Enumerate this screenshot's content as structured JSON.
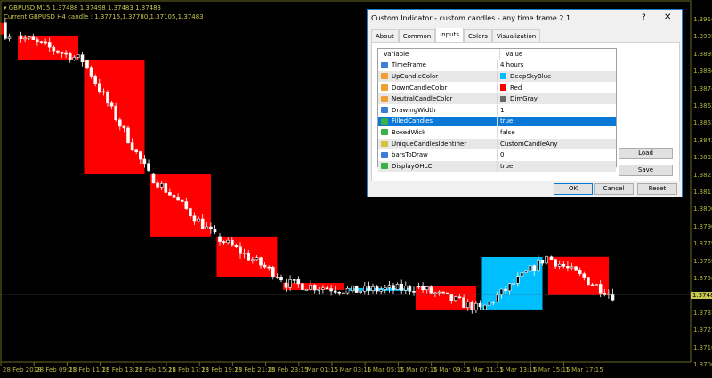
{
  "chart": {
    "symbol_line": "GBPUSD,M15  1.37488 1.37498 1.37483 1.37483",
    "h4_line": "Current GBPUSD H4 candle : 1.37716,1.37780,1.37105,1.37483",
    "up_color": "#00bfff",
    "down_color": "#ff0000",
    "price_axis": [
      "1.39160",
      "1.39055",
      "1.38950",
      "1.38845",
      "1.38740",
      "1.38635",
      "1.38530",
      "1.38425",
      "1.38320",
      "1.38215",
      "1.38110",
      "1.38005",
      "1.37900",
      "1.37795",
      "1.37690",
      "1.37585",
      "1.37483",
      "1.37375",
      "1.37270",
      "1.37165",
      "1.37060"
    ],
    "price_min": 1.3706,
    "price_max": 1.3916,
    "current_price": "1.37483",
    "time_axis": [
      "28 Feb 2018",
      "28 Feb 09:15",
      "28 Feb 11:15",
      "28 Feb 13:15",
      "28 Feb 15:15",
      "28 Feb 17:15",
      "28 Feb 19:15",
      "28 Feb 21:15",
      "28 Feb 23:15",
      "1 Mar 01:15",
      "1 Mar 03:15",
      "1 Mar 05:15",
      "1 Mar 07:15",
      "1 Mar 09:15",
      "1 Mar 11:15",
      "1 Mar 13:15",
      "1 Mar 15:15",
      "1 Mar 17:15"
    ],
    "h4_candles": [
      {
        "open": 1.3914,
        "close": 1.3907
      },
      {
        "open": 1.39063,
        "close": 1.38911
      },
      {
        "open": 1.38911,
        "close": 1.38218
      },
      {
        "open": 1.38218,
        "close": 1.3784
      },
      {
        "open": 1.3784,
        "close": 1.37591
      },
      {
        "open": 1.37558,
        "close": 1.37515
      },
      {
        "open": 1.3751,
        "close": 1.37526
      },
      {
        "open": 1.37537,
        "close": 1.37396
      },
      {
        "open": 1.37396,
        "close": 1.37715
      },
      {
        "open": 1.37716,
        "close": 1.37483
      }
    ]
  },
  "dialog": {
    "title": "Custom Indicator - custom candles - any time frame 2.1",
    "help": "?",
    "close": "✕",
    "tabs": [
      "About",
      "Common",
      "Inputs",
      "Colors",
      "Visualization"
    ],
    "columns": [
      "Variable",
      "Value"
    ],
    "rows": [
      {
        "icon": "123",
        "name": "TimeFrame",
        "value": "4 hours"
      },
      {
        "icon": "clr",
        "name": "UpCandleColor",
        "value": "DeepSkyBlue",
        "swatch": "#00bfff"
      },
      {
        "icon": "clr",
        "name": "DownCandleColor",
        "value": "Red",
        "swatch": "#ff0000"
      },
      {
        "icon": "clr",
        "name": "NeutralCandleColor",
        "value": "DimGray",
        "swatch": "#696969"
      },
      {
        "icon": "123",
        "name": "DrawingWidth",
        "value": "1"
      },
      {
        "icon": "bool",
        "name": "FilledCandles",
        "value": "true"
      },
      {
        "icon": "bool",
        "name": "BoxedWick",
        "value": "false"
      },
      {
        "icon": "ab",
        "name": "UniqueCandlesIdentifier",
        "value": "CustomCandleAny"
      },
      {
        "icon": "123",
        "name": "barsToDraw",
        "value": "0"
      },
      {
        "icon": "bool",
        "name": "DisplayOHLC",
        "value": "true"
      }
    ],
    "load": "Load",
    "save": "Save",
    "ok": "OK",
    "cancel": "Cancel",
    "reset": "Reset"
  }
}
